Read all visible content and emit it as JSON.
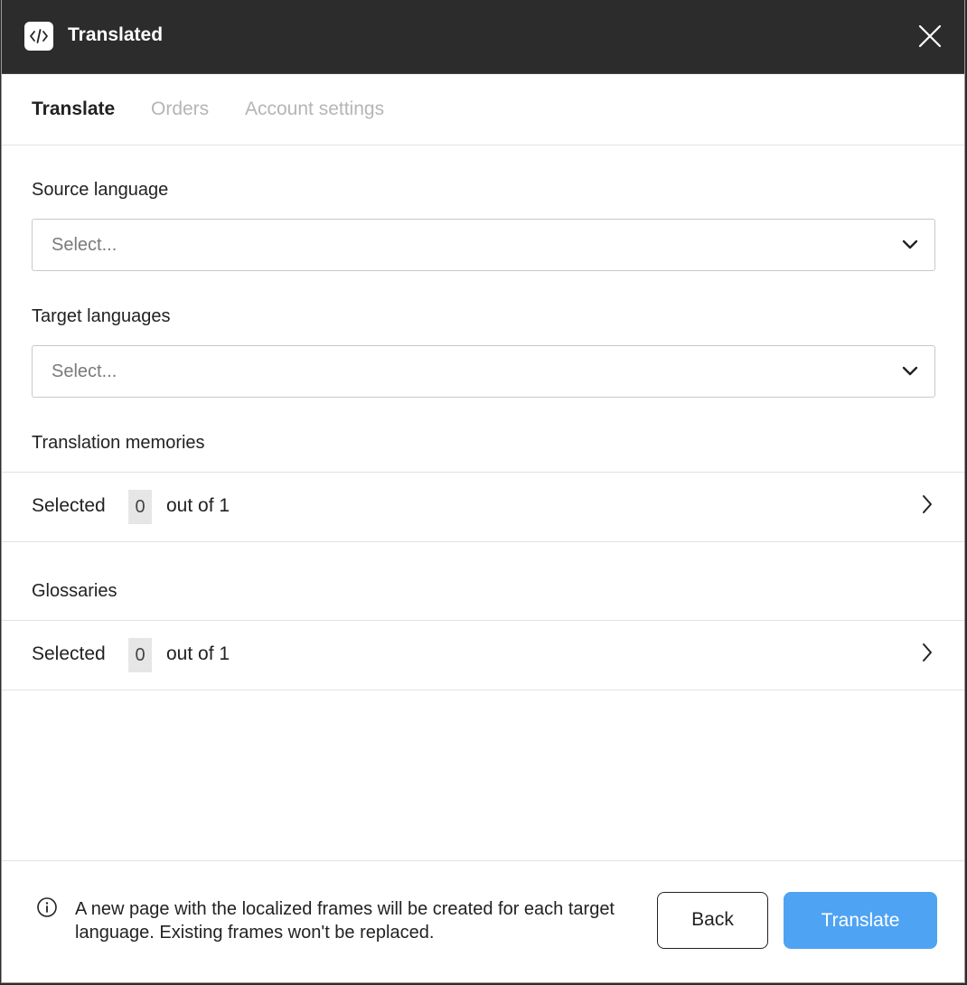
{
  "window": {
    "title": "Translated",
    "app_icon": "code-brackets-icon",
    "close_icon": "close-icon"
  },
  "tabs": [
    {
      "label": "Translate",
      "active": true
    },
    {
      "label": "Orders",
      "active": false
    },
    {
      "label": "Account settings",
      "active": false
    }
  ],
  "form": {
    "source_language": {
      "label": "Source language",
      "placeholder": "Select..."
    },
    "target_languages": {
      "label": "Target languages",
      "placeholder": "Select..."
    },
    "translation_memories": {
      "label": "Translation memories",
      "selected_prefix": "Selected",
      "selected_count": "0",
      "total_text": "out of 1"
    },
    "glossaries": {
      "label": "Glossaries",
      "selected_prefix": "Selected",
      "selected_count": "0",
      "total_text": "out of 1"
    }
  },
  "footer": {
    "info_text": "A new page with the localized frames will be created for each target language. Existing frames won't be replaced.",
    "back_label": "Back",
    "translate_label": "Translate"
  },
  "colors": {
    "titlebar": "#2c2c2c",
    "accent": "#4ea3f3",
    "muted_tab": "#b5b5b5"
  }
}
